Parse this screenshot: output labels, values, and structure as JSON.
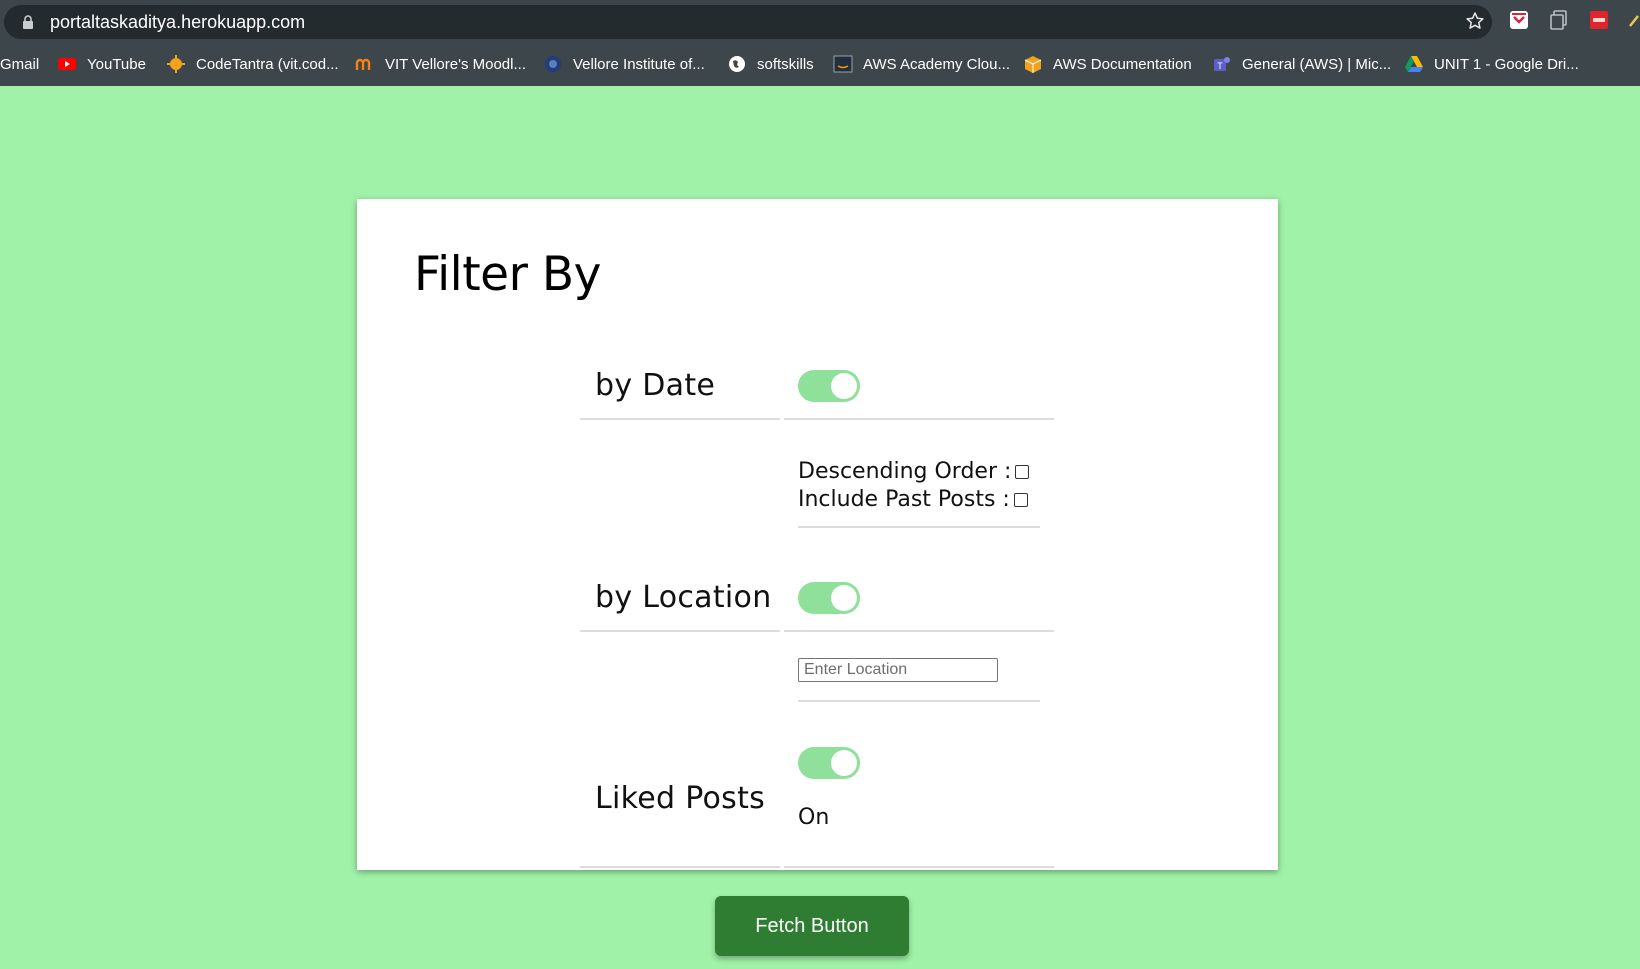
{
  "browser": {
    "url": "portaltaskaditya.herokuapp.com",
    "bookmarks": [
      {
        "label": "Gmail",
        "icon": "gmail-icon"
      },
      {
        "label": "YouTube",
        "icon": "youtube-icon"
      },
      {
        "label": "CodeTantra (vit.cod...",
        "icon": "codetantra-icon"
      },
      {
        "label": "VIT Vellore's Moodl...",
        "icon": "moodle-icon"
      },
      {
        "label": "Vellore Institute of...",
        "icon": "vit-icon"
      },
      {
        "label": "softskills",
        "icon": "globe-icon"
      },
      {
        "label": "AWS Academy Clou...",
        "icon": "aws-icon"
      },
      {
        "label": "AWS Documentation",
        "icon": "aws-doc-icon"
      },
      {
        "label": "General (AWS) | Mic...",
        "icon": "teams-icon"
      },
      {
        "label": "UNIT 1 - Google Dri...",
        "icon": "google-drive-icon"
      }
    ]
  },
  "filter": {
    "title": "Filter By",
    "date": {
      "label": "by Date",
      "enabled": true,
      "descending_label": "Descending Order :",
      "past_label": "Include Past Posts :"
    },
    "location": {
      "label": "by Location",
      "enabled": true,
      "placeholder": "Enter Location"
    },
    "liked": {
      "label": "Liked Posts",
      "enabled": true,
      "status": "On"
    }
  },
  "fetch_button": "Fetch Button",
  "colors": {
    "page_background": "#a0f2a8",
    "toggle_on": "#8ee09a",
    "button": "#2e7d32"
  }
}
